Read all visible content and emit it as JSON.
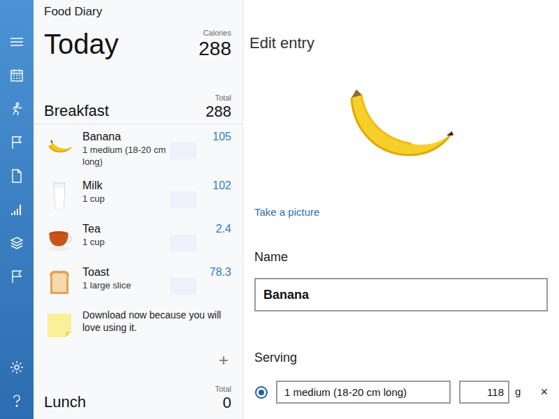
{
  "app": {
    "title": "Food Diary"
  },
  "day": {
    "title": "Today",
    "calories_label": "Calories",
    "calories": "288"
  },
  "meals": [
    {
      "name": "Breakfast",
      "total_label": "Total",
      "total": "288",
      "entries": [
        {
          "name": "Banana",
          "serving": "1 medium (18-20 cm long)",
          "calories": "105"
        },
        {
          "name": "Milk",
          "serving": "1 cup",
          "calories": "102"
        },
        {
          "name": "Tea",
          "serving": "1 cup",
          "calories": "2.4"
        },
        {
          "name": "Toast",
          "serving": "1 large slice",
          "calories": "78.3"
        }
      ],
      "note": "Download now because you will love using it.",
      "add": "+"
    },
    {
      "name": "Lunch",
      "total_label": "Total",
      "total": "0",
      "entries": []
    }
  ],
  "editor": {
    "title": "Edit entry",
    "photo_action": "Take a picture",
    "name_label": "Name",
    "name": "Banana",
    "serving_label": "Serving",
    "servings": [
      {
        "selected": true,
        "label": "1 medium (18-20 cm long)",
        "grams": "118",
        "unit": "g",
        "remove": "×"
      }
    ]
  }
}
